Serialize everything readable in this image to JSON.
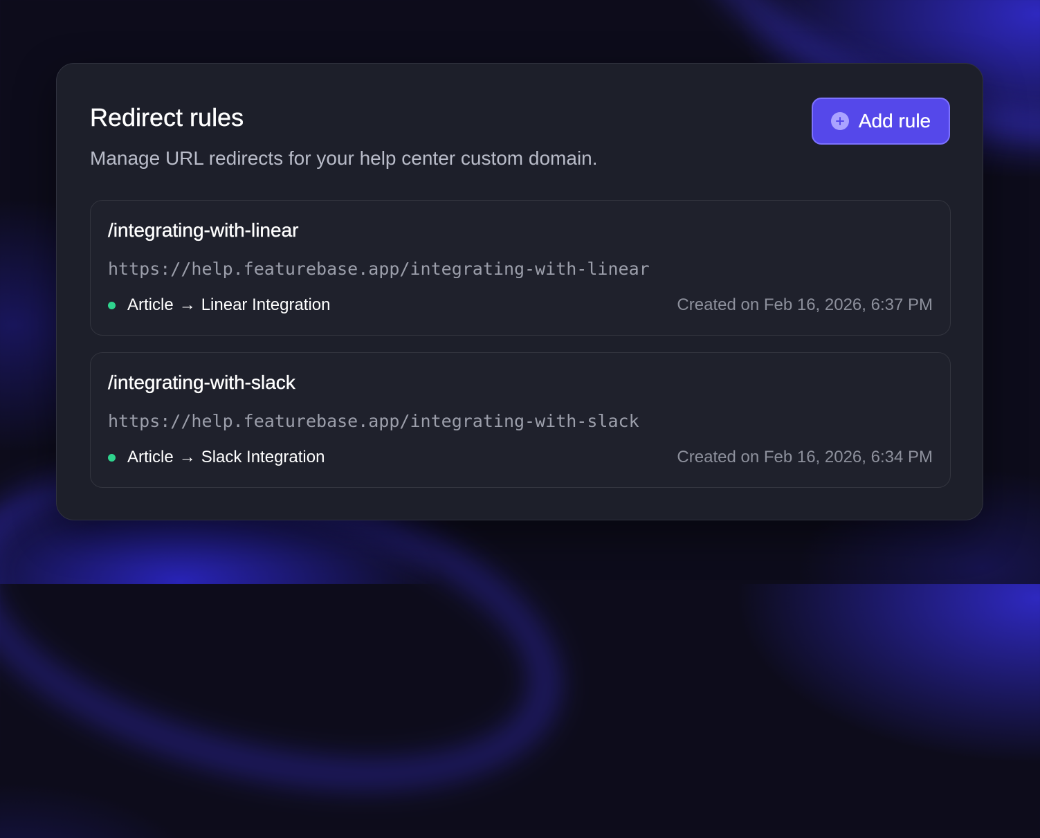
{
  "header": {
    "title": "Redirect rules",
    "subtitle": "Manage URL redirects for your help center custom domain.",
    "add_button_label": "Add rule"
  },
  "icons": {
    "add_button": "plus-circle-icon",
    "status": "status-dot-icon",
    "arrow": "arrow-right-icon"
  },
  "colors": {
    "accent": "#5548EA",
    "status_active": "#2FD48E"
  },
  "rules": [
    {
      "path": "/integrating-with-linear",
      "url": "https://help.featurebase.app/integrating-with-linear",
      "target_type": "Article",
      "target_name": "Linear Integration",
      "created": "Created on Feb 16, 2026, 6:37 PM"
    },
    {
      "path": "/integrating-with-slack",
      "url": "https://help.featurebase.app/integrating-with-slack",
      "target_type": "Article",
      "target_name": "Slack Integration",
      "created": "Created on Feb 16, 2026, 6:34 PM"
    }
  ]
}
